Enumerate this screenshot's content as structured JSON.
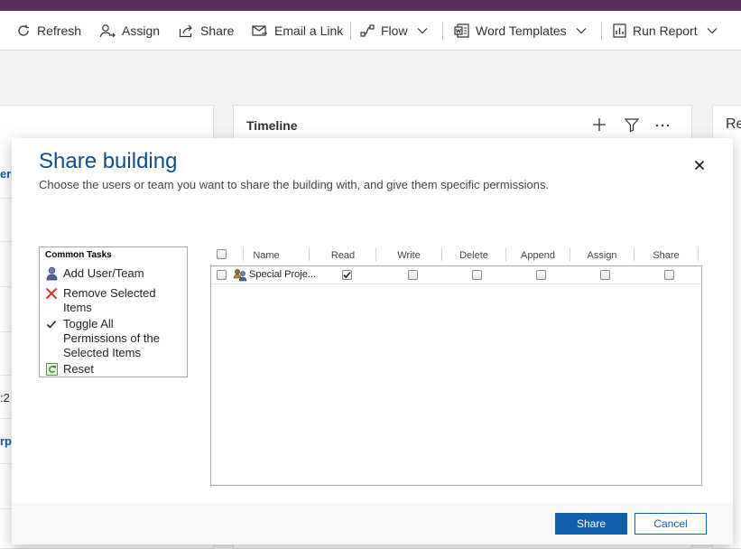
{
  "commandbar": {
    "items": [
      {
        "label": "Refresh",
        "icon": "refresh-icon"
      },
      {
        "label": "Assign",
        "icon": "assign-user-icon"
      },
      {
        "label": "Share",
        "icon": "share-icon"
      },
      {
        "label": "Email a Link",
        "icon": "email-icon"
      },
      {
        "label": "Flow",
        "icon": "flow-icon"
      },
      {
        "label": "Word Templates",
        "icon": "word-icon"
      },
      {
        "label": "Run Report",
        "icon": "report-icon"
      }
    ]
  },
  "background": {
    "left_fragments": [
      "er",
      ":2",
      "rp"
    ],
    "timeline_title": "Timeline",
    "right_title": "Re"
  },
  "modal": {
    "title": "Share building",
    "subtitle": "Choose the users or team you want to share the building with, and give them specific permissions.",
    "common_tasks": {
      "title": "Common Tasks",
      "items": [
        {
          "label": "Add User/Team",
          "icon": "add-user-icon"
        },
        {
          "label": "Remove Selected Items",
          "icon": "remove-x-icon"
        },
        {
          "label": "Toggle All Permissions of the Selected Items",
          "icon": "checkmark-icon"
        },
        {
          "label": "Reset",
          "icon": "reset-icon"
        }
      ]
    },
    "grid": {
      "columns": [
        "Name",
        "Read",
        "Write",
        "Delete",
        "Append",
        "Assign",
        "Share"
      ],
      "rows": [
        {
          "name": "Special Proje...",
          "read": true,
          "write": false,
          "delete": false,
          "append": false,
          "assign": false,
          "share": false
        }
      ]
    },
    "buttons": {
      "share": "Share",
      "cancel": "Cancel"
    }
  },
  "colors": {
    "brand_strip": "#5c2d5f",
    "title_blue": "#0f4c8a",
    "primary_button": "#0f5fae"
  }
}
